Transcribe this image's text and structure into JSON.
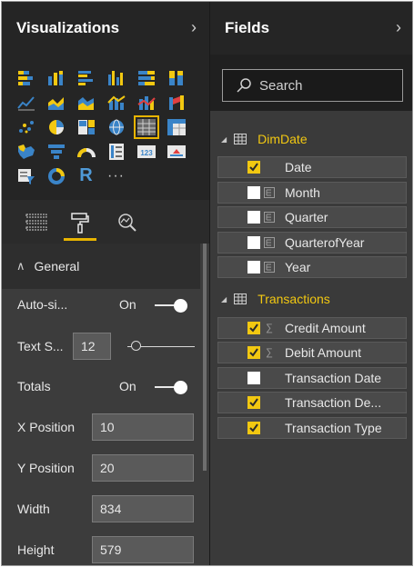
{
  "visualizations": {
    "title": "Visualizations",
    "expand_icon": "chevron-right-icon",
    "icons": [
      "stacked-bar-chart-icon",
      "stacked-column-chart-icon",
      "clustered-bar-chart-icon",
      "clustered-column-chart-icon",
      "100-stacked-bar-chart-icon",
      "100-stacked-column-chart-icon",
      "line-chart-icon",
      "area-chart-icon",
      "stacked-area-chart-icon",
      "line-clustered-column-icon",
      "line-stacked-column-icon",
      "ribbon-chart-icon",
      "scatter-chart-icon",
      "pie-chart-icon",
      "treemap-icon",
      "globe-map-icon",
      "table-icon",
      "matrix-icon",
      "filled-map-icon",
      "funnel-icon",
      "gauge-icon",
      "multi-row-card-icon",
      "card-icon",
      "kpi-icon",
      "slicer-icon",
      "donut-chart-icon",
      "r-visual-icon",
      "more-visuals-icon"
    ],
    "r_label": "R",
    "more_label": "···",
    "selected_icon": "table-icon",
    "tabs": [
      "fields-tab",
      "format-tab",
      "analytics-tab"
    ],
    "active_tab": "format-tab"
  },
  "format": {
    "section_title": "General",
    "rows": {
      "auto_size": {
        "label": "Auto-si...",
        "value": "On"
      },
      "text_size": {
        "label": "Text S...",
        "value": "12"
      },
      "totals": {
        "label": "Totals",
        "value": "On"
      },
      "x_position": {
        "label": "X Position",
        "value": "10"
      },
      "y_position": {
        "label": "Y Position",
        "value": "20"
      },
      "width": {
        "label": "Width",
        "value": "834"
      },
      "height": {
        "label": "Height",
        "value": "579"
      }
    }
  },
  "fields": {
    "title": "Fields",
    "expand_icon": "chevron-right-icon",
    "search_placeholder": "Search",
    "tables": [
      {
        "name": "DimDate",
        "items": [
          {
            "name": "Date",
            "checked": true,
            "type": ""
          },
          {
            "name": "Month",
            "checked": false,
            "type": "hierarchy"
          },
          {
            "name": "Quarter",
            "checked": false,
            "type": "hierarchy"
          },
          {
            "name": "QuarterofYear",
            "checked": false,
            "type": "hierarchy"
          },
          {
            "name": "Year",
            "checked": false,
            "type": "hierarchy"
          }
        ]
      },
      {
        "name": "Transactions",
        "items": [
          {
            "name": "Credit Amount",
            "checked": true,
            "type": "sum"
          },
          {
            "name": "Debit Amount",
            "checked": true,
            "type": "sum"
          },
          {
            "name": "Transaction Date",
            "checked": false,
            "type": ""
          },
          {
            "name": "Transaction De...",
            "checked": true,
            "type": ""
          },
          {
            "name": "Transaction Type",
            "checked": true,
            "type": ""
          }
        ]
      }
    ]
  },
  "colors": {
    "accent": "#f2c811",
    "panel_dark": "#252525",
    "panel": "#3a3a3a",
    "text": "#e8e8e8"
  }
}
